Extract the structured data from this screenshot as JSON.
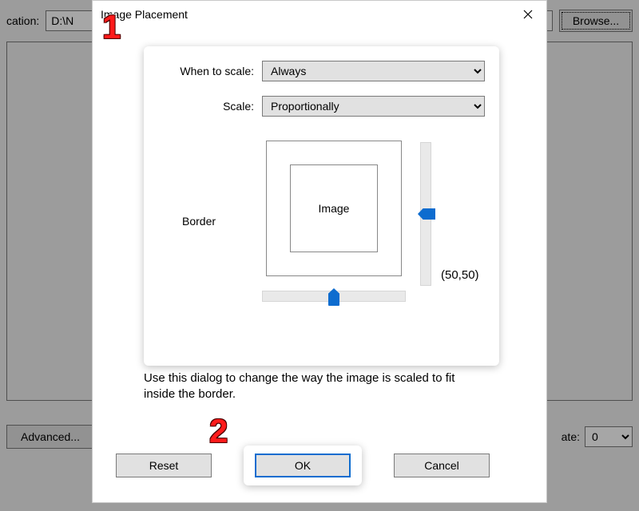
{
  "bg": {
    "location_label": "cation:",
    "path_value": "D:\\N",
    "browse_label": "Browse...",
    "advanced_label": "Advanced...",
    "rate_label": "ate:",
    "rate_value": "0"
  },
  "dialog": {
    "title": "Image Placement",
    "when_to_scale_label": "When to scale:",
    "when_to_scale_value": "Always",
    "scale_label": "Scale:",
    "scale_value": "Proportionally",
    "border_label": "Border",
    "image_label": "Image",
    "coord_text": "(50,50)",
    "help_text": "Use this dialog to change the way the image is scaled to fit inside the border.",
    "reset_label": "Reset",
    "ok_label": "OK",
    "cancel_label": "Cancel"
  },
  "annotations": {
    "one": "1",
    "two": "2"
  }
}
